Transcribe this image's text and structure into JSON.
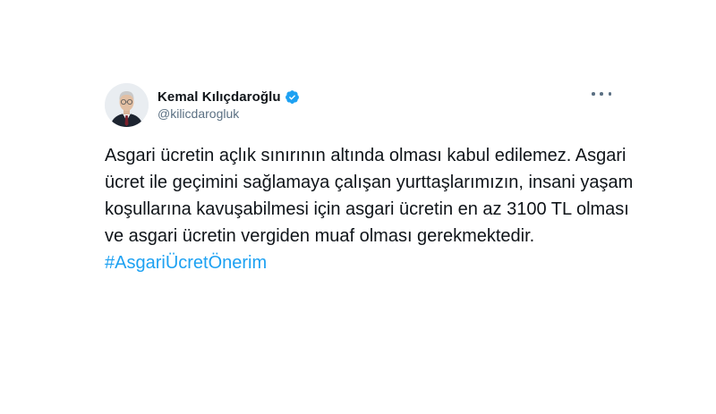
{
  "author": {
    "display_name": "Kemal Kılıçdaroğlu",
    "handle": "@kilicdarogluk",
    "verified": true
  },
  "tweet": {
    "text": "Asgari ücretin açlık sınırının altında olması kabul edilemez. Asgari ücret ile geçimini sağlamaya çalışan yurttaşlarımızın, insani yaşam koşullarına kavuşabilmesi için asgari ücretin en az 3100 TL olması ve asgari ücretin vergiden muaf olması gerekmektedir.",
    "hashtag": "#AsgariÜcretÖnerim"
  },
  "colors": {
    "hashtag": "#1da1f2",
    "verified_badge": "#1da1f2",
    "handle": "#5b7083"
  },
  "icons": {
    "verified": "verified-badge-icon",
    "more": "more-horizontal-icon"
  }
}
